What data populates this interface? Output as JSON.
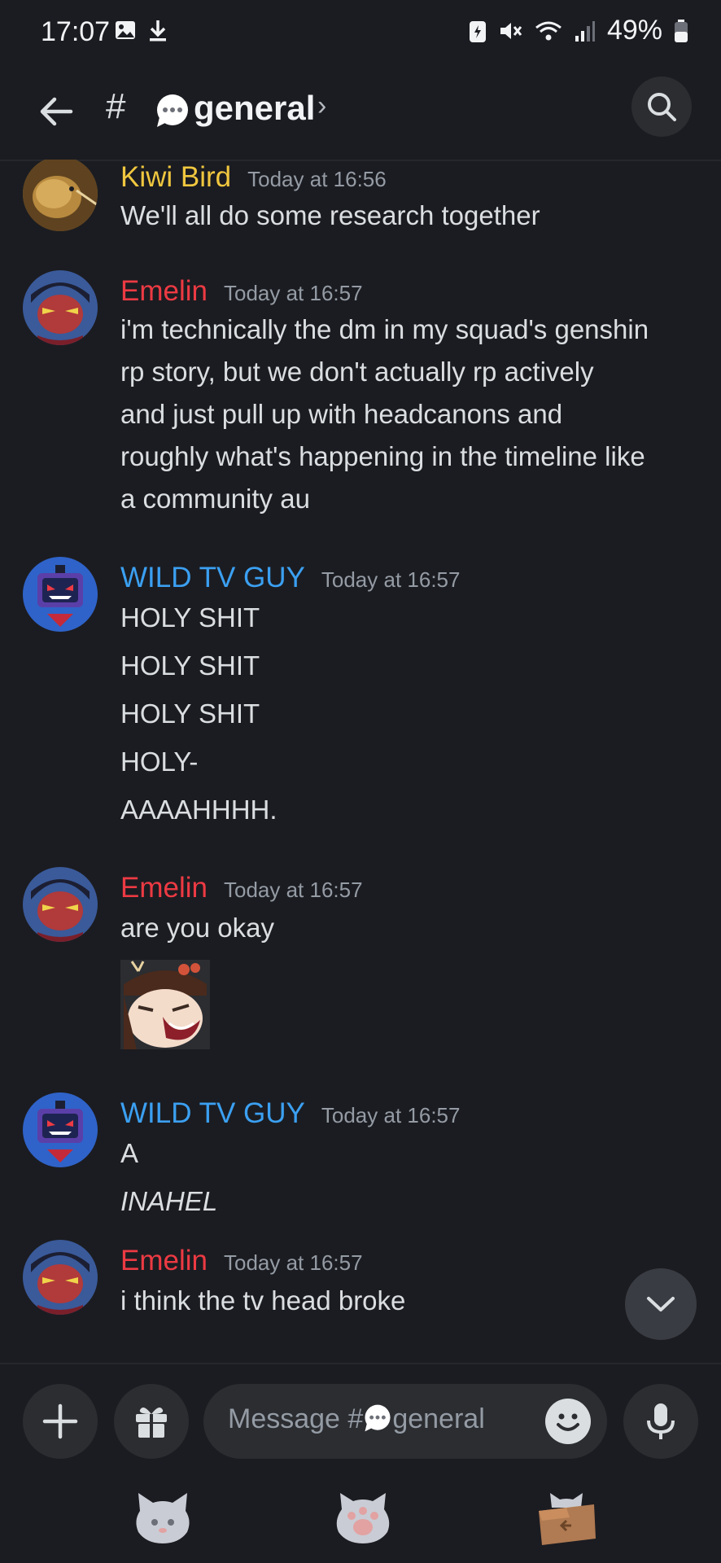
{
  "status_bar": {
    "time": "17:07",
    "battery": "49%"
  },
  "header": {
    "hash": "#",
    "channel_name": "general"
  },
  "messages": [
    {
      "author": "Kiwi Bird",
      "color": "#f0c73f",
      "timestamp": "Today at 16:56",
      "lines": [
        "We'll all do some research together"
      ]
    },
    {
      "author": "Emelin",
      "color": "#ed3a43",
      "timestamp": "Today at 16:57",
      "lines": [
        "i'm technically the dm in my squad's genshin",
        "rp story, but we don't actually rp actively",
        "and just pull up with headcanons and",
        "roughly what's happening in the timeline like",
        "a community au"
      ]
    },
    {
      "author": "WILD TV GUY",
      "color": "#3ba0f2",
      "timestamp": "Today at 16:57",
      "lines": [
        "HOLY SHIT",
        "HOLY SHIT",
        "HOLY SHIT",
        "HOLY-",
        "AAAAHHHH."
      ]
    },
    {
      "author": "Emelin",
      "color": "#ed3a43",
      "timestamp": "Today at 16:57",
      "lines": [
        "are you okay"
      ]
    },
    {
      "author": "WILD TV GUY",
      "color": "#3ba0f2",
      "timestamp": "Today at 16:57",
      "lines": [
        "A",
        "INAHEL"
      ]
    },
    {
      "author": "Emelin",
      "color": "#ed3a43",
      "timestamp": "Today at 16:57",
      "lines": [
        "i think the tv head broke"
      ]
    }
  ],
  "composer": {
    "placeholder_prefix": "Message #",
    "placeholder_channel": "general"
  },
  "icons": {
    "back": "arrow-left-icon",
    "search": "search-icon",
    "add": "plus-icon",
    "gift": "gift-icon",
    "emoji": "emoji-icon",
    "mic": "microphone-icon",
    "scroll_down": "chevron-down-icon"
  }
}
